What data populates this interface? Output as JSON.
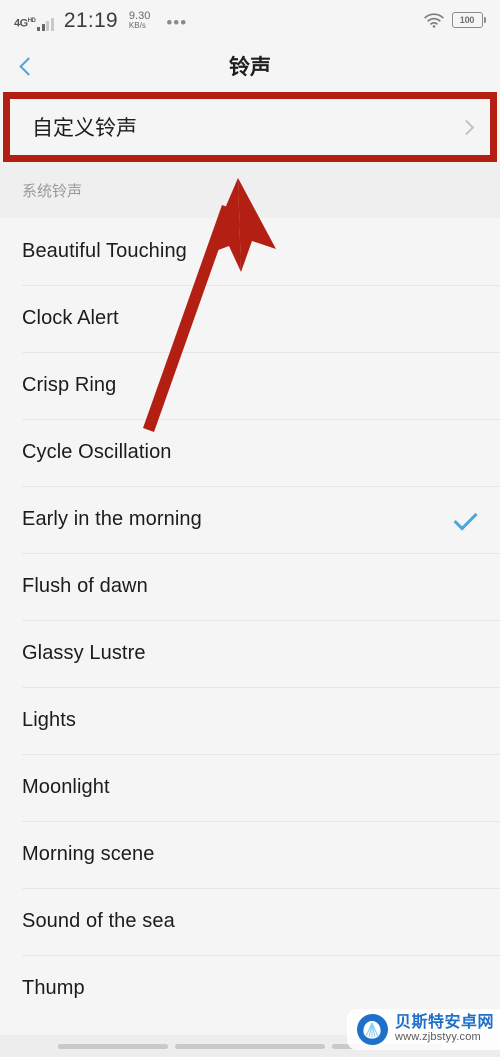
{
  "status_bar": {
    "network_type": "4G",
    "network_sup": "HD",
    "time": "21:19",
    "speed_value": "9.30",
    "speed_unit": "KB/s",
    "overflow": "•••",
    "wifi_icon": "wifi-icon",
    "battery_level": "100"
  },
  "header": {
    "back_icon": "back-chevron-icon",
    "title": "铃声"
  },
  "custom_ringtone": {
    "label": "自定义铃声",
    "chevron_icon": "chevron-right-icon",
    "highlight_color": "#b31f12"
  },
  "section": {
    "header": "系统铃声"
  },
  "ringtones": [
    {
      "name": "Beautiful Touching",
      "selected": false
    },
    {
      "name": "Clock Alert",
      "selected": false
    },
    {
      "name": "Crisp Ring",
      "selected": false
    },
    {
      "name": "Cycle Oscillation",
      "selected": false
    },
    {
      "name": "Early in the morning",
      "selected": true
    },
    {
      "name": "Flush of dawn",
      "selected": false
    },
    {
      "name": "Glassy Lustre",
      "selected": false
    },
    {
      "name": "Lights",
      "selected": false
    },
    {
      "name": "Moonlight",
      "selected": false
    },
    {
      "name": "Morning scene",
      "selected": false
    },
    {
      "name": "Sound of the sea",
      "selected": false
    },
    {
      "name": "Thump",
      "selected": false
    }
  ],
  "annotation": {
    "arrow_icon": "red-arrow-annotation",
    "color": "#b31f12"
  },
  "watermark": {
    "logo_icon": "shell-logo-icon",
    "site_name": "贝斯特安卓网",
    "url": "www.zjbstyy.com"
  },
  "nav_bar": {
    "icon": "android-nav-bar"
  },
  "colors": {
    "accent_blue": "#4ea3e0",
    "annotation_red": "#b31f12",
    "page_bg": "#f5f5f5",
    "section_bg": "#efefef"
  }
}
